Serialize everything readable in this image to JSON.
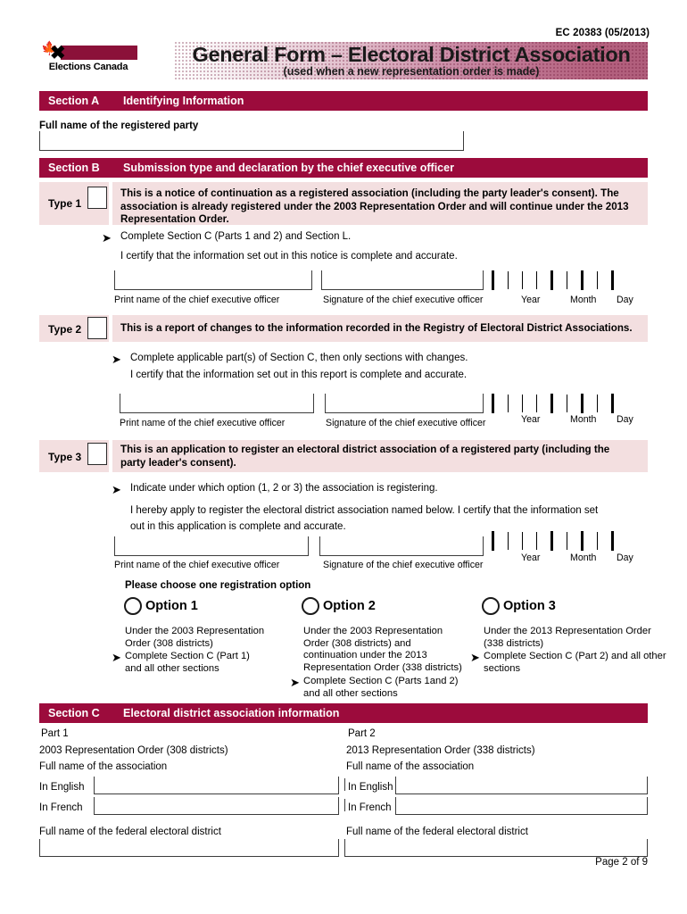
{
  "meta": {
    "form_number": "EC 20383 (05/2013)",
    "page_label": "Page 2 of 9"
  },
  "header": {
    "logo_wordmark": "Elections Canada",
    "logo_leaf_icon": "maple-leaf-icon",
    "logo_x_icon": "x-mark-icon",
    "title": "General Form – Electoral District Association",
    "subtitle": "(used when a new representation order is made)",
    "banner_color_left": "#ffffff",
    "banner_color_right": "#b5627f"
  },
  "colors": {
    "section_bar": "#9c0b3c",
    "callout_pink": "#f3dfe0",
    "ink": "#000000"
  },
  "section_a": {
    "label": "Section A",
    "title": "Identifying Information",
    "party_name_label": "Full name of the registered party",
    "party_name_value": "",
    "party_name_placeholder": ""
  },
  "section_b": {
    "label": "Section B",
    "title": "Submission type and declaration by the chief executive officer",
    "types": [
      {
        "type_label": "Type 1",
        "checked": false,
        "statement": "This is a notice of continuation as a registered association (including the party leader's consent). The association is already registered under the 2003 Representation Order and will continue under the 2013 Representation Order.",
        "instruction": "Complete Section C (Parts 1 and 2) and Section L.",
        "certify": "I certify that the information set out in this notice is complete and accurate.",
        "print_name_caption": "Print name of the chief executive officer",
        "print_name_value": "",
        "signature_caption": "Signature of the chief executive officer",
        "signature_value": "",
        "date_year_caption": "Year",
        "date_month_caption": "Month",
        "date_day_caption": "Day"
      },
      {
        "type_label": "Type 2",
        "checked": false,
        "statement": "This is a report of changes to the information recorded in the Registry of Electoral District Associations.",
        "instruction": "Complete applicable part(s) of Section C, then only sections with changes.",
        "certify": "I certify that the information set out in this report is complete and accurate.",
        "print_name_caption": "Print name of the chief executive officer",
        "print_name_value": "",
        "signature_caption": "Signature of the chief executive officer",
        "signature_value": "",
        "date_year_caption": "Year",
        "date_month_caption": "Month",
        "date_day_caption": "Day"
      },
      {
        "type_label": "Type 3",
        "checked": false,
        "statement": "This is an application to register an electoral district association of a registered party (including the party leader's consent).",
        "instruction": "Indicate under which option (1, 2 or 3) the association is registering.",
        "certify_line1": "I hereby apply to register the electoral district association named below. I certify that the information set",
        "certify_line2": "out in this application is complete and accurate.",
        "print_name_caption": "Print name of the chief executive officer",
        "print_name_value": "",
        "signature_caption": "Signature of the chief executive officer",
        "signature_value": "",
        "date_year_caption": "Year",
        "date_month_caption": "Month",
        "date_day_caption": "Day"
      }
    ],
    "options_heading": "Please choose one registration option",
    "options": [
      {
        "label": "Option 1",
        "selected": false,
        "description": "Under the 2003 Representation\nOrder (308 districts)",
        "action": "Complete Section C (Part 1)\nand all other sections"
      },
      {
        "label": "Option 2",
        "selected": false,
        "description": "Under the 2003 Representation\nOrder (308 districts) and\ncontinuation under the 2013\nRepresentation Order (338 districts)",
        "action": "Complete Section C (Parts 1and 2)\nand all other sections"
      },
      {
        "label": "Option 3",
        "selected": false,
        "description": "Under the 2013 Representation Order\n(338 districts)",
        "action": "Complete Section C (Part 2) and all other\nsections"
      }
    ]
  },
  "section_c": {
    "label": "Section C",
    "title": "Electoral district association information",
    "parts": [
      {
        "part_label": "Part 1",
        "order_label": "2003 Representation Order (308 districts)",
        "association_name_label": "Full name of the association",
        "english_label": "In English",
        "english_value": "",
        "french_label": "In French",
        "french_value": "",
        "district_label": "Full name of the federal electoral district",
        "district_value": ""
      },
      {
        "part_label": "Part 2",
        "order_label": "2013 Representation Order (338 districts)",
        "association_name_label": "Full name of the association",
        "english_label": "In English",
        "english_value": "",
        "french_label": "In French",
        "french_value": "",
        "district_label": "Full name of the federal electoral district",
        "district_value": ""
      }
    ]
  }
}
